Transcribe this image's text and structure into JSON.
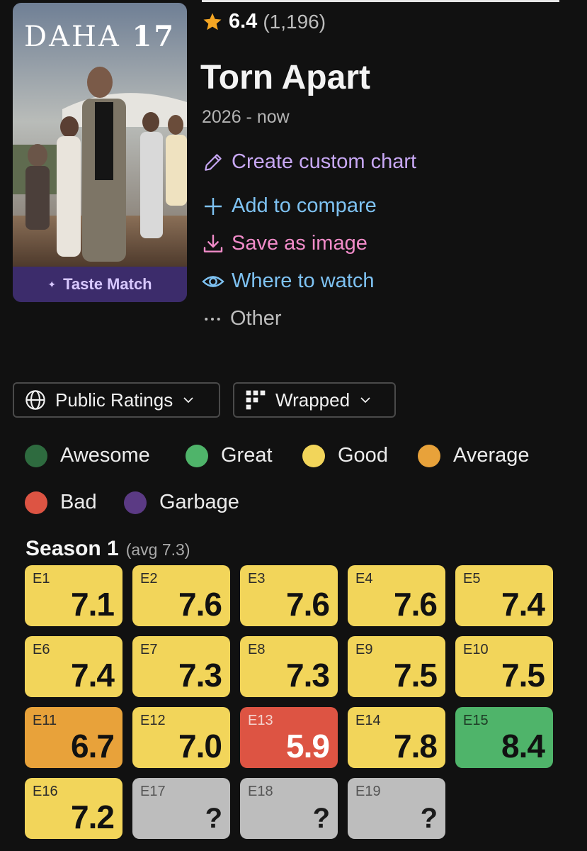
{
  "show": {
    "title": "Torn Apart",
    "years": "2026 - now",
    "rating": "6.4",
    "rating_count": "(1,196)",
    "poster_logo_text": "DAHA",
    "poster_logo_number": "17",
    "taste_match_label": "Taste Match"
  },
  "actions": {
    "create_chart": "Create custom chart",
    "add_compare": "Add to compare",
    "save_image": "Save as image",
    "where_watch": "Where to watch",
    "other": "Other"
  },
  "controls": {
    "ratings_label": "Public Ratings",
    "layout_label": "Wrapped"
  },
  "legend": [
    {
      "label": "Awesome",
      "color": "#2e6b3f"
    },
    {
      "label": "Great",
      "color": "#4fb46a"
    },
    {
      "label": "Good",
      "color": "#f2d55a"
    },
    {
      "label": "Average",
      "color": "#e8a23a"
    },
    {
      "label": "Bad",
      "color": "#dd5443"
    },
    {
      "label": "Garbage",
      "color": "#5b3a84"
    }
  ],
  "season": {
    "name": "Season 1",
    "avg": "(avg 7.3)",
    "episodes": [
      {
        "ep": "E1",
        "score": "7.1",
        "tier": "good"
      },
      {
        "ep": "E2",
        "score": "7.6",
        "tier": "good"
      },
      {
        "ep": "E3",
        "score": "7.6",
        "tier": "good"
      },
      {
        "ep": "E4",
        "score": "7.6",
        "tier": "good"
      },
      {
        "ep": "E5",
        "score": "7.4",
        "tier": "good"
      },
      {
        "ep": "E6",
        "score": "7.4",
        "tier": "good"
      },
      {
        "ep": "E7",
        "score": "7.3",
        "tier": "good"
      },
      {
        "ep": "E8",
        "score": "7.3",
        "tier": "good"
      },
      {
        "ep": "E9",
        "score": "7.5",
        "tier": "good"
      },
      {
        "ep": "E10",
        "score": "7.5",
        "tier": "good"
      },
      {
        "ep": "E11",
        "score": "6.7",
        "tier": "average"
      },
      {
        "ep": "E12",
        "score": "7.0",
        "tier": "good"
      },
      {
        "ep": "E13",
        "score": "5.9",
        "tier": "bad"
      },
      {
        "ep": "E14",
        "score": "7.8",
        "tier": "good"
      },
      {
        "ep": "E15",
        "score": "8.4",
        "tier": "great"
      },
      {
        "ep": "E16",
        "score": "7.2",
        "tier": "good"
      },
      {
        "ep": "E17",
        "score": "?",
        "tier": "unrated"
      },
      {
        "ep": "E18",
        "score": "?",
        "tier": "unrated"
      },
      {
        "ep": "E19",
        "score": "?",
        "tier": "unrated"
      }
    ]
  },
  "tier_colors": {
    "good": {
      "bg": "#f2d55a",
      "fg": "#111111",
      "ep": "#2b2b2b"
    },
    "average": {
      "bg": "#e8a23a",
      "fg": "#111111",
      "ep": "#2b2b2b"
    },
    "bad": {
      "bg": "#dd5443",
      "fg": "#ffffff",
      "ep": "#f4d4cf"
    },
    "great": {
      "bg": "#4fb46a",
      "fg": "#111111",
      "ep": "#1e3b26"
    },
    "unrated": {
      "bg": "#bdbdbd",
      "fg": "#1a1a1a",
      "ep": "#555555"
    }
  },
  "icons": {
    "star": "star-icon",
    "pencil": "pencil-icon",
    "plus": "plus-icon",
    "download": "download-icon",
    "eye": "eye-icon",
    "dots": "more-dots-icon",
    "globe": "globe-icon",
    "grid": "grid-icon",
    "chevron": "chevron-down-icon"
  }
}
